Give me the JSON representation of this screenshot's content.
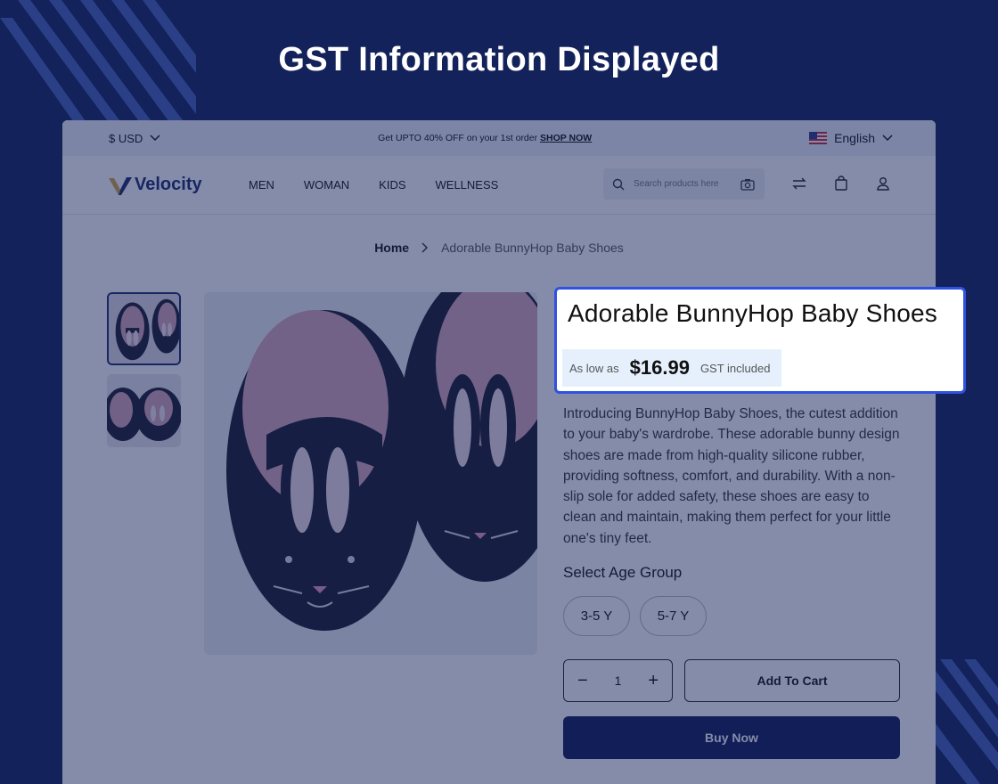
{
  "headline": "GST Information Displayed",
  "topbar": {
    "currency": "$ USD",
    "promo_text": "Get UPTO 40% OFF on your 1st order",
    "promo_link": "SHOP NOW",
    "language": "English"
  },
  "header": {
    "logo_text": "Velocity",
    "nav": [
      "MEN",
      "WOMAN",
      "KIDS",
      "WELLNESS"
    ],
    "search_placeholder": "Search products here"
  },
  "breadcrumb": {
    "home": "Home",
    "current": "Adorable BunnyHop Baby Shoes"
  },
  "product": {
    "title": "Adorable BunnyHop Baby Shoes",
    "price_prefix": "As low as",
    "price": "$16.99",
    "price_suffix": "GST included",
    "description": "Introducing BunnyHop Baby Shoes, the cutest addition to your baby's wardrobe. These adorable bunny design shoes are made from high-quality silicone rubber, providing softness, comfort, and durability. With a non-slip sole for added safety, these shoes are easy to clean and maintain, making them perfect for your little one's tiny feet.",
    "age_label": "Select Age Group",
    "age_options": [
      "3-5 Y",
      "5-7 Y"
    ],
    "quantity": "1",
    "add_to_cart": "Add To Cart",
    "buy_now": "Buy Now"
  },
  "colors": {
    "background": "#13225a",
    "highlight_border": "#2f52e0",
    "price_box": "#e6f0fd",
    "buy_now": "#0f1a55"
  }
}
